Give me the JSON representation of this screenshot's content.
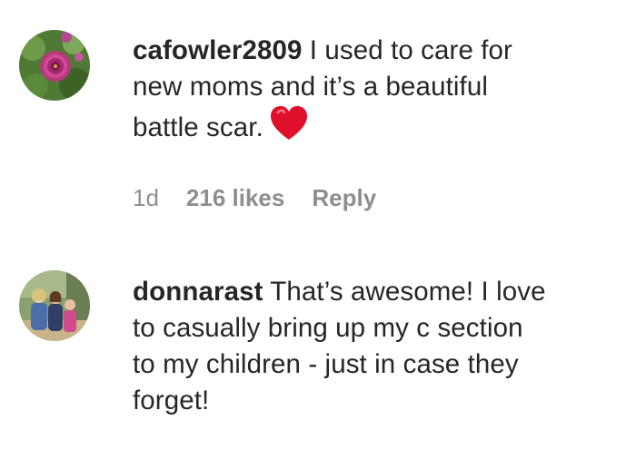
{
  "comments": [
    {
      "username": "cafowler2809",
      "text_line1": " I used to care for",
      "text_line2": "new moms and it’s a beautiful",
      "text_line3": "battle scar.",
      "emoji": "red-heart-icon",
      "time": "1d",
      "likes": "216 likes",
      "reply": "Reply",
      "avatar": "flower-avatar"
    },
    {
      "username": "donnarast",
      "text_line1": " That’s awesome! I love",
      "text_line2": "to casually bring up my c section",
      "text_line3": "to my children - just in case they",
      "text_line4": "forget!",
      "avatar": "family-photo-avatar"
    }
  ],
  "colors": {
    "text": "#262626",
    "meta": "#8e8e8e",
    "heart": "#e0102a"
  }
}
